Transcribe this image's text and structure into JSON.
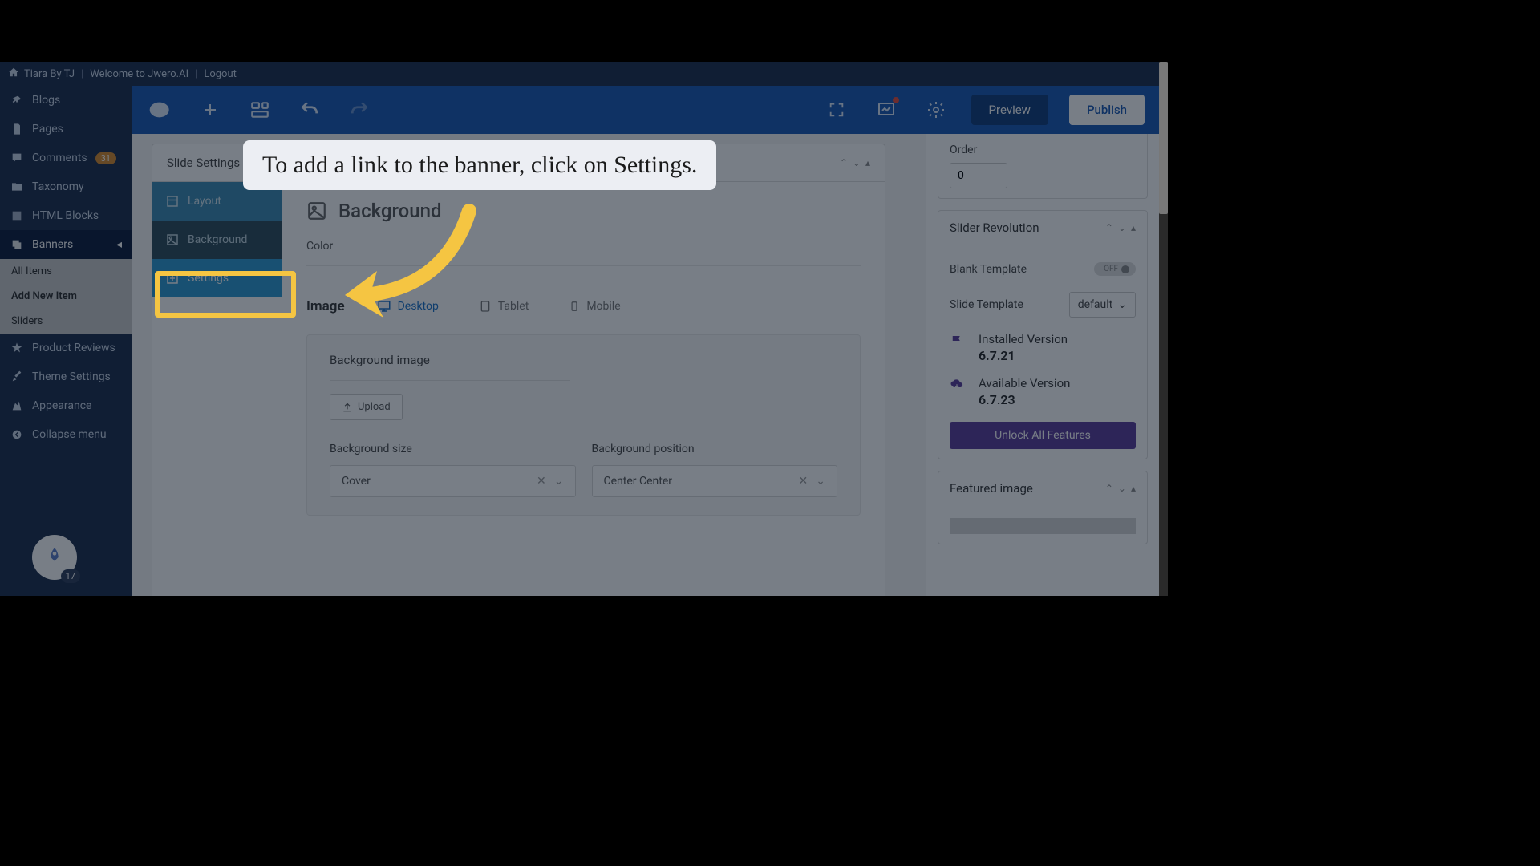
{
  "topbar": {
    "site": "Tiara By TJ",
    "welcome": "Welcome to Jwero.AI",
    "logout": "Logout"
  },
  "sidebar": {
    "blogs": "Blogs",
    "pages": "Pages",
    "comments": "Comments",
    "comments_count": "31",
    "taxonomy": "Taxonomy",
    "html_blocks": "HTML Blocks",
    "banners": "Banners",
    "all_items": "All Items",
    "add_new": "Add New Item",
    "sliders": "Sliders",
    "reviews": "Product Reviews",
    "theme_settings": "Theme Settings",
    "appearance": "Appearance",
    "collapse": "Collapse menu",
    "rocket_badge": "17"
  },
  "toolbar": {
    "preview": "Preview",
    "publish": "Publish"
  },
  "slide": {
    "header": "Slide Settings",
    "tab_layout": "Layout",
    "tab_background": "Background",
    "tab_settings": "Settings",
    "bg_title": "Background",
    "color_label": "Color",
    "image_label": "Image",
    "desktop": "Desktop",
    "tablet": "Tablet",
    "mobile": "Mobile",
    "bg_image_label": "Background image",
    "upload": "Upload",
    "bg_size": "Background size",
    "bg_size_val": "Cover",
    "bg_pos": "Background position",
    "bg_pos_val": "Center Center"
  },
  "right": {
    "order_label": "Order",
    "order_val": "0",
    "sr_title": "Slider Revolution",
    "blank_template": "Blank Template",
    "toggle_off": "OFF",
    "slide_template": "Slide Template",
    "default": "default",
    "installed": "Installed Version",
    "installed_v": "6.7.21",
    "available": "Available Version",
    "available_v": "6.7.23",
    "unlock": "Unlock All Features",
    "featured": "Featured image"
  },
  "tooltip": {
    "text": "To add a link to the banner, click on Settings."
  }
}
